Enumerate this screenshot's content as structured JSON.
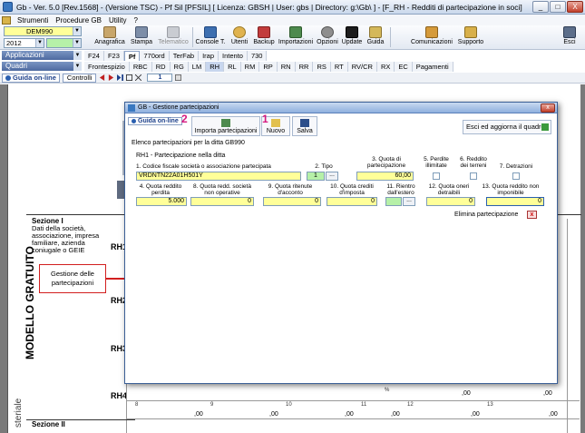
{
  "window": {
    "title": "Gb - Ver. 5.0 [Rev.1568] - (Versione TSC) - Pf Sil [PFSIL]   [ Licenza: GBSH | User: gbs | Directory: g:\\Gb\\ ] - [F_RH - Redditi di partecipazione in soci]",
    "controls": [
      "_",
      "□",
      "X"
    ]
  },
  "menu": [
    "Strumenti",
    "Procedure GB",
    "Utility",
    "?"
  ],
  "toolbar": {
    "client_combo": "DEM990",
    "year_combo": "2012",
    "buttons": [
      {
        "label": "Anagrafica",
        "icon": "id-card-icon",
        "enabled": true
      },
      {
        "label": "Stampa",
        "icon": "printer-icon",
        "enabled": true
      },
      {
        "label": "Telematico",
        "icon": "telematico-icon",
        "enabled": false
      },
      {
        "label": "Console T.",
        "icon": "console-icon",
        "enabled": true
      },
      {
        "label": "Utenti",
        "icon": "users-icon",
        "enabled": true
      },
      {
        "label": "Backup",
        "icon": "backup-icon",
        "enabled": true
      },
      {
        "label": "Importazioni",
        "icon": "import-icon",
        "enabled": true
      },
      {
        "label": "Opzioni",
        "icon": "options-icon",
        "enabled": true
      },
      {
        "label": "Update",
        "icon": "update-icon",
        "enabled": true
      },
      {
        "label": "Guida",
        "icon": "help-icon",
        "enabled": true
      },
      {
        "label": "Comunicazioni",
        "icon": "communications-icon",
        "enabled": true
      },
      {
        "label": "Supporto",
        "icon": "support-icon",
        "enabled": true
      },
      {
        "label": "Esci",
        "icon": "exit-icon",
        "enabled": true
      }
    ]
  },
  "sections": {
    "applicazioni_label": "Applicazioni",
    "quadri_label": "Quadri",
    "app_tabs": [
      "F24",
      "F23",
      "Pf",
      "770ord",
      "TerFab",
      "Irap",
      "Intento",
      "730"
    ],
    "app_active": "Pf",
    "quadri_tabs": [
      "Frontespizio",
      "RBC",
      "RD",
      "RG",
      "LM",
      "RH",
      "RL",
      "RM",
      "RP",
      "RN",
      "RR",
      "RS",
      "RT",
      "RV/CR",
      "RX",
      "EC",
      "Pagamenti"
    ],
    "quadri_active": "RH"
  },
  "guidarow": {
    "guida_label": "Guida on-line",
    "controlli_label": "Controlli",
    "page_value": "1"
  },
  "document": {
    "side_label": "MODELLO GRATUITO",
    "side_label_2": "steriale",
    "sezione1_title": "Sezione I",
    "sezione1_text": "Dati della società, associazione, impresa familiare, azienda coniugale o GEIE",
    "sezione2_title": "Sezione II",
    "rh_rows": [
      "RH1",
      "RH2",
      "RH3",
      "RH4"
    ],
    "bottom_field_numbers": [
      "8",
      "9",
      "10",
      "11",
      "12",
      "13"
    ],
    "bottom_values": [
      ",00",
      ",00",
      ",00",
      ",00",
      ",00",
      ",00"
    ],
    "rh4_values": [
      ",00",
      ",00"
    ],
    "percent_mark": "%"
  },
  "callout": {
    "text": "Gestione delle partecipazioni"
  },
  "dialog": {
    "title": "GB - Gestione partecipazioni",
    "guida_label": "Guida on-line",
    "buttons": {
      "importa": "Importa partecipazioni",
      "nuovo": "Nuovo",
      "salva": "Salva",
      "esci_aggiorna": "Esci ed aggiorna il quadro"
    },
    "step_numbers": [
      "2",
      "1"
    ],
    "elenco_text": "Elenco partecipazioni per la ditta GB990",
    "rh1_text": "RH1 - Partecipazione nella ditta",
    "fields": {
      "f1_label": "1. Codice fiscale società o associazione partecipata",
      "f1_value": "VRDNTN22A01H501Y",
      "f2_label": "2. Tipo",
      "f2_value": "1",
      "f3_label": "3. Quota di partecipazione",
      "f3_value": "60,00",
      "f5_label": "5. Perdite illimitate",
      "f6_label": "6. Reddito dei terreni",
      "f7_label": "7. Detrazioni",
      "f4_label": "4. Quota reddito perdita",
      "f4_value": "5.000",
      "f8_label": "8. Quota redd. società non operative",
      "f8_value": "0",
      "f9_label": "9. Quota ritenute d'acconto",
      "f9_value": "0",
      "f10_label": "10. Quota crediti d'imposta",
      "f10_value": "0",
      "f11_label": "11. Rientro dall'estero",
      "f12_label": "12. Quota oneri detraibili",
      "f12_value": "0",
      "f13_label": "13. Quota reddito non imponibile",
      "f13_value": "0"
    },
    "elimina_label": "Elimina partecipazione",
    "dots": "..."
  },
  "colors": {
    "accent_blue": "#4e6aa0",
    "highlight_yellow": "#ffff99",
    "highlight_green": "#b6f0a8",
    "callout_red": "#d21f1f",
    "step_pink": "#d6187f"
  }
}
